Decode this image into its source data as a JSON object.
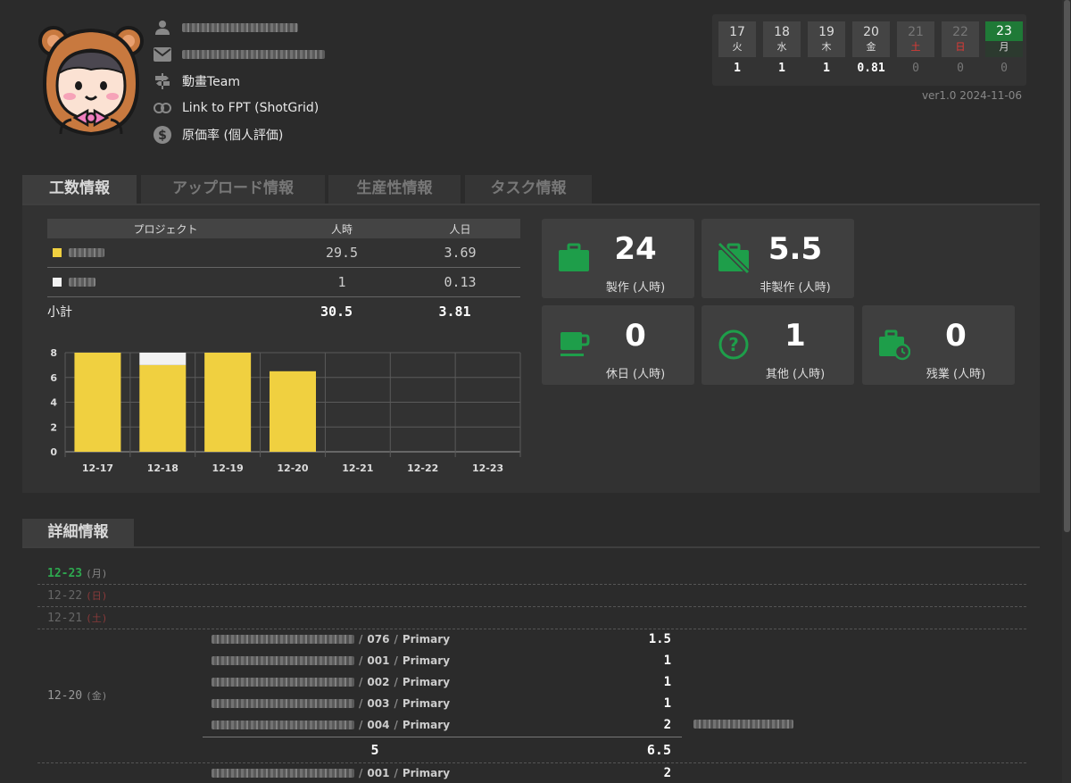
{
  "profile": {
    "team": "動畫Team",
    "link": "Link to FPT (ShotGrid)",
    "rate": "原価率 (個人評価)"
  },
  "calendar": [
    {
      "day": "17",
      "weekday": "火",
      "value": "1"
    },
    {
      "day": "18",
      "weekday": "水",
      "value": "1"
    },
    {
      "day": "19",
      "weekday": "木",
      "value": "1"
    },
    {
      "day": "20",
      "weekday": "金",
      "value": "0.81"
    },
    {
      "day": "21",
      "weekday": "土",
      "value": "0"
    },
    {
      "day": "22",
      "weekday": "日",
      "value": "0"
    },
    {
      "day": "23",
      "weekday": "月",
      "value": "0"
    }
  ],
  "version": "ver1.0  2024-11-06",
  "tabs": [
    "工数情報",
    "アップロード情報",
    "生産性情報",
    "タスク情報"
  ],
  "table": {
    "headers": [
      "プロジェクト",
      "人時",
      "人日"
    ],
    "rows": [
      {
        "color": "#f0d040",
        "hours": "29.5",
        "days": "3.69"
      },
      {
        "color": "#f2f2f2",
        "hours": "1",
        "days": "0.13"
      }
    ],
    "total": {
      "label": "小計",
      "hours": "30.5",
      "days": "3.81"
    }
  },
  "stats": {
    "production": {
      "value": "24",
      "label": "製作 (人時)"
    },
    "non_production": {
      "value": "5.5",
      "label": "非製作 (人時)"
    },
    "holiday": {
      "value": "0",
      "label": "休日 (人時)"
    },
    "other": {
      "value": "1",
      "label": "其他 (人時)"
    },
    "overtime": {
      "value": "0",
      "label": "残業 (人時)"
    }
  },
  "colors": {
    "accent": "#1f7a37",
    "icon_green": "#1e9e4a",
    "bar_yellow": "#f0d040",
    "bar_white": "#f2f2f2"
  },
  "chart_data": {
    "type": "bar",
    "stacked": true,
    "categories": [
      "12-17",
      "12-18",
      "12-19",
      "12-20",
      "12-21",
      "12-22",
      "12-23"
    ],
    "series": [
      {
        "color": "#f0d040",
        "values": [
          8,
          7,
          8,
          6.5,
          0,
          0,
          0
        ]
      },
      {
        "color": "#f2f2f2",
        "values": [
          0,
          1,
          0,
          0,
          0,
          0,
          0
        ]
      }
    ],
    "ylim": [
      0,
      8
    ],
    "yticks": [
      "0",
      "2",
      "4",
      "6",
      "8"
    ],
    "grid": true
  },
  "detail": {
    "title": "詳細情報",
    "dates": [
      {
        "date": "12-23",
        "weekday": "(月)",
        "color": "#2ea84f"
      },
      {
        "date": "12-22",
        "weekday": "(日)",
        "color": "#666"
      },
      {
        "date": "12-21",
        "weekday": "(土)",
        "color": "#666"
      },
      {
        "date": "12-20",
        "weekday": "(金)",
        "color": "#999"
      }
    ],
    "tasks": [
      {
        "shot": "076",
        "type": "Primary",
        "hours": "1.5"
      },
      {
        "shot": "001",
        "type": "Primary",
        "hours": "1"
      },
      {
        "shot": "002",
        "type": "Primary",
        "hours": "1"
      },
      {
        "shot": "003",
        "type": "Primary",
        "hours": "1"
      },
      {
        "shot": "004",
        "type": "Primary",
        "hours": "2"
      }
    ],
    "subtotal": {
      "count": "5",
      "hours": "6.5"
    },
    "next_task": {
      "shot": "001",
      "type": "Primary",
      "hours": "2"
    }
  }
}
